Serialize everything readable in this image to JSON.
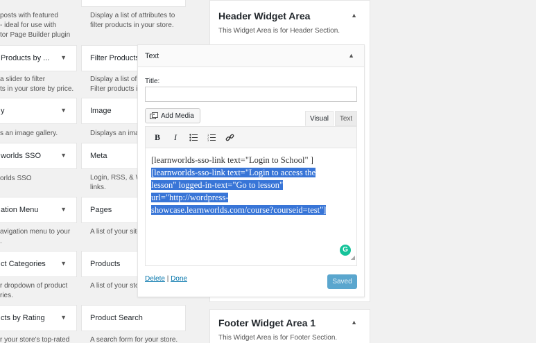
{
  "left_col": [
    {
      "title": "",
      "desc": "posts with featured\n- ideal for use with\ntor Page Builder plugin"
    },
    {
      "title": "Products by ...",
      "desc": "a slider to filter\nts in your store by price."
    },
    {
      "title": "y",
      "desc": "s an image gallery."
    },
    {
      "title": "worlds SSO",
      "desc": "orlds SSO"
    },
    {
      "title": "ation Menu",
      "desc": "avigation menu to your\n."
    },
    {
      "title": "ct Categories",
      "desc": "r dropdown of product\nries."
    },
    {
      "title": "cts by Rating",
      "desc": "r your store's top-rated"
    }
  ],
  "mid_col": [
    {
      "title": "",
      "desc": "Display a list of attributes to\nfilter products in your store."
    },
    {
      "title": "Filter Products",
      "desc": "Display a list of s\nFilter products in"
    },
    {
      "title": "Image",
      "desc": "Displays an ima"
    },
    {
      "title": "Meta",
      "desc": "Login, RSS, & W\nlinks."
    },
    {
      "title": "Pages",
      "desc": "A list of your site"
    },
    {
      "title": "Products",
      "desc": "A list of your sto"
    },
    {
      "title": "Product Search",
      "desc": "A search form for your store."
    }
  ],
  "header_area": {
    "title": "Header Widget Area",
    "desc": "This Widget Area is for Header Section."
  },
  "footer_area": {
    "title": "Footer Widget Area 1",
    "desc": "This Widget Area is for Footer Section."
  },
  "text_widget": {
    "header": "Text",
    "title_label": "Title:",
    "title_value": "",
    "add_media": "Add Media",
    "tab_visual": "Visual",
    "tab_text": "Text",
    "line1": "[learnworlds-sso-link text=\"Login to School\"  ]",
    "sel_line1": "[learnworlds-sso-link text=\"Login to access the",
    "sel_line2": "lesson\" logged-in-text=\"Go to lesson\"",
    "sel_line3": "url=\"http://wordpress-",
    "sel_line4": "showcase.learnworlds.com/course?courseid=test\"]",
    "delete": "Delete",
    "separator": "|",
    "done": "Done",
    "saved": "Saved",
    "grammarly": "G"
  },
  "icons": {
    "arrow_down": "▼",
    "arrow_up": "▲"
  }
}
